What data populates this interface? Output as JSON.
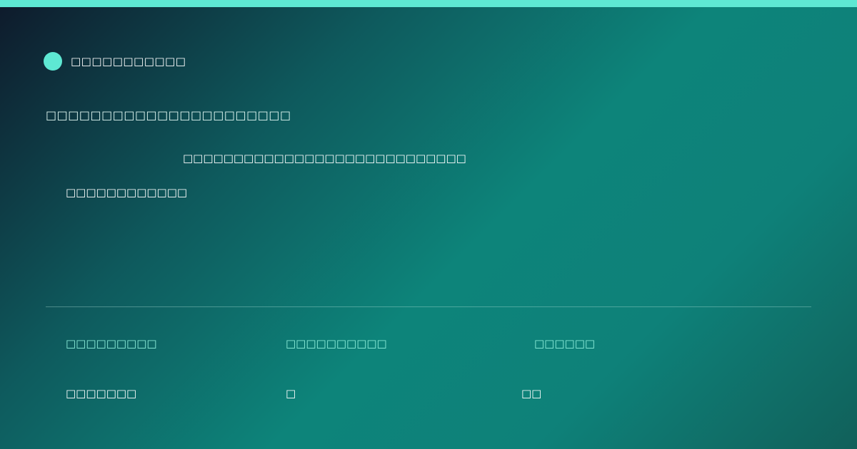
{
  "colors": {
    "accent": "#5ee8d3",
    "background_start": "#0e1a2b",
    "background_mid": "#0d847a",
    "background_end": "#11605a",
    "stat_label": "#8ff0dc"
  },
  "brand": {
    "icon": "brand-dot-icon",
    "name": "□□□□□□□□□□□"
  },
  "main": {
    "headline": "□□□□□□□□□□□□□□□□□□□□□□",
    "subtext": "□□□□□□□□□□□□□□□□□□□□□□□□□□□□",
    "subtext_2": "□□□□□□□□□□□□"
  },
  "stats": [
    {
      "label": "□□□□□□□□□",
      "value": "□□□□□□□"
    },
    {
      "label": "□□□□□□□□□□",
      "value": "□"
    },
    {
      "label": "□□□□□□",
      "value": "□□"
    }
  ]
}
